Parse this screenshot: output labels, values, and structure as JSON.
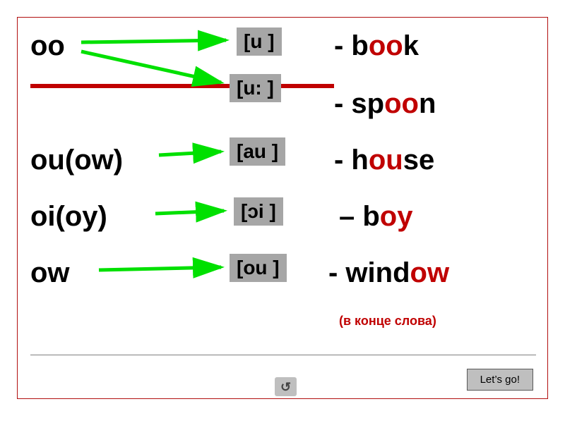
{
  "rows": [
    {
      "spelling": "oo",
      "word_pre": "- b",
      "word_hl": "oo",
      "word_post": "k"
    },
    {
      "spelling": "",
      "word_pre": "- sp",
      "word_hl": "oo",
      "word_post": "n"
    },
    {
      "spelling": "ou(ow)",
      "word_pre": "- h",
      "word_hl": "ou",
      "word_post": "se"
    },
    {
      "spelling": "oi(oy)",
      "word_pre": "– b",
      "word_hl": "oy",
      "word_post": ""
    },
    {
      "spelling": "ow",
      "word_pre": "- wind",
      "word_hl": "ow",
      "word_post": ""
    }
  ],
  "phonetics": {
    "u_short": "[u ]",
    "u_long": "[u: ]",
    "au": "[au ]",
    "oi": "[ɔi ]",
    "ou": "[ou ]"
  },
  "note": "(в конце слова)",
  "go_button": "Let’s go!",
  "back_glyph": "↺",
  "colors": {
    "accent": "#c00000",
    "arrow": "#00e000"
  }
}
